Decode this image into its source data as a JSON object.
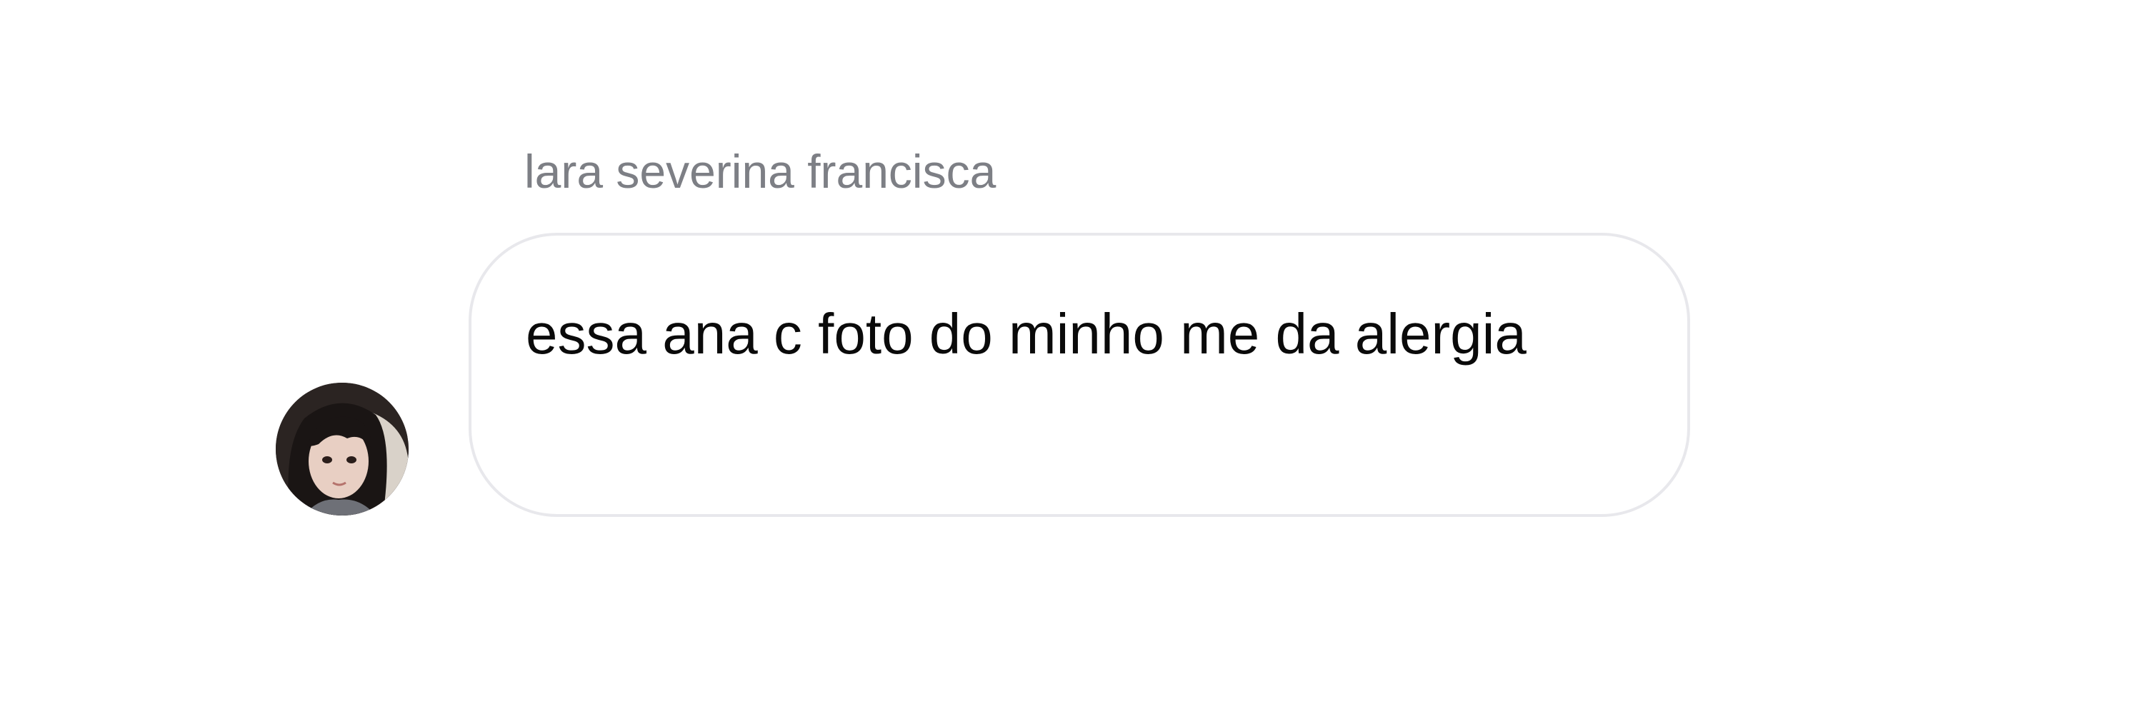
{
  "message": {
    "sender_name": "lara severina francisca",
    "text": "essa ana c foto do minho me da alergia"
  },
  "avatar": {
    "icon": "profile-photo-avatar"
  },
  "colors": {
    "background": "#ffffff",
    "sender_name": "#7d7f85",
    "bubble_border": "#e8e8ec",
    "message_text": "#0a0a0a"
  }
}
